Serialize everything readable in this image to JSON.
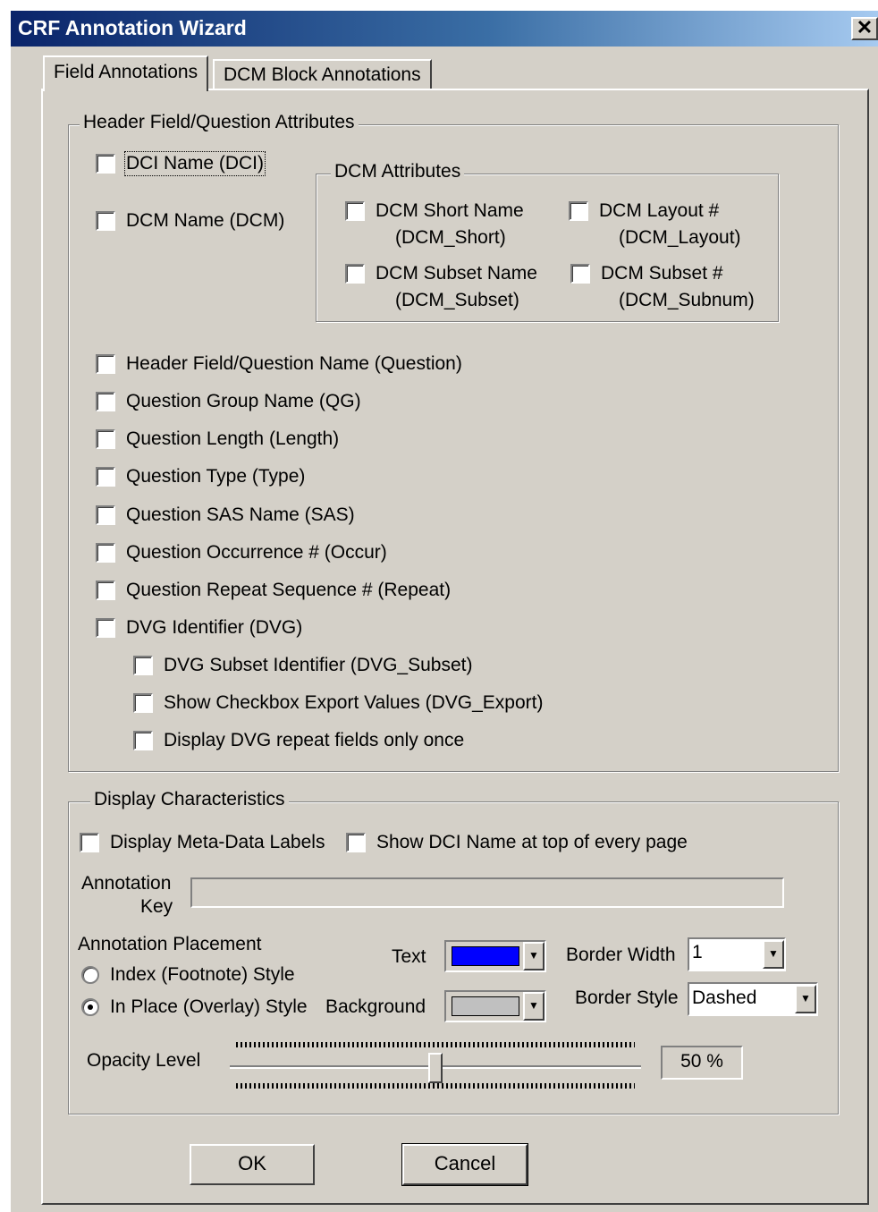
{
  "window": {
    "title": "CRF Annotation Wizard",
    "close_glyph": "✕"
  },
  "tabs": [
    {
      "label": "Field Annotations",
      "active": true
    },
    {
      "label": "DCM Block Annotations",
      "active": false
    }
  ],
  "header_group": {
    "legend": "Header Field/Question Attributes",
    "dci_name": {
      "label": "DCI Name (DCI)",
      "checked": false
    },
    "dcm_name": {
      "label": "DCM Name (DCM)",
      "checked": false
    },
    "dcm_attributes": {
      "legend": "DCM Attributes",
      "short_name": {
        "line1": "DCM Short Name",
        "line2": "(DCM_Short)",
        "checked": false
      },
      "layout": {
        "line1": "DCM Layout #",
        "line2": "(DCM_Layout)",
        "checked": false
      },
      "subset_name": {
        "line1": "DCM Subset Name",
        "line2": "(DCM_Subset)",
        "checked": false
      },
      "subset_num": {
        "line1": "DCM Subset #",
        "line2": "(DCM_Subnum)",
        "checked": false
      }
    },
    "items": [
      {
        "label": "Header Field/Question Name (Question)",
        "checked": false
      },
      {
        "label": "Question Group Name (QG)",
        "checked": false
      },
      {
        "label": "Question Length (Length)",
        "checked": false
      },
      {
        "label": "Question Type (Type)",
        "checked": false
      },
      {
        "label": "Question SAS Name (SAS)",
        "checked": false
      },
      {
        "label": "Question Occurrence # (Occur)",
        "checked": false
      },
      {
        "label": "Question Repeat Sequence # (Repeat)",
        "checked": false
      },
      {
        "label": "DVG Identifier (DVG)",
        "checked": false
      }
    ],
    "sub_items": [
      {
        "label": "DVG Subset Identifier (DVG_Subset)",
        "checked": false
      },
      {
        "label": "Show Checkbox Export Values (DVG_Export)",
        "checked": false
      },
      {
        "label": "Display DVG repeat fields only once",
        "checked": false
      }
    ]
  },
  "display_group": {
    "legend": "Display Characteristics",
    "meta_labels": {
      "label": "Display Meta-Data Labels",
      "checked": false
    },
    "show_dci": {
      "label": "Show DCI Name at top of every page",
      "checked": false
    },
    "annotation_key": {
      "label_line1": "Annotation",
      "label_line2": "Key",
      "value": ""
    },
    "placement": {
      "label": "Annotation Placement",
      "options": [
        {
          "label": "Index (Footnote) Style",
          "selected": false
        },
        {
          "label": "In Place (Overlay) Style",
          "selected": true
        }
      ]
    },
    "text_color": {
      "label": "Text",
      "color": "#0000ff"
    },
    "background_color": {
      "label": "Background",
      "color": "#c0c0c0"
    },
    "border_width": {
      "label": "Border Width",
      "value": "1"
    },
    "border_style": {
      "label": "Border Style",
      "value": "Dashed"
    },
    "opacity": {
      "label": "Opacity Level",
      "value_text": "50 %",
      "level": 0.5
    }
  },
  "buttons": {
    "ok": "OK",
    "cancel": "Cancel"
  },
  "dropdown_arrow": "▼"
}
